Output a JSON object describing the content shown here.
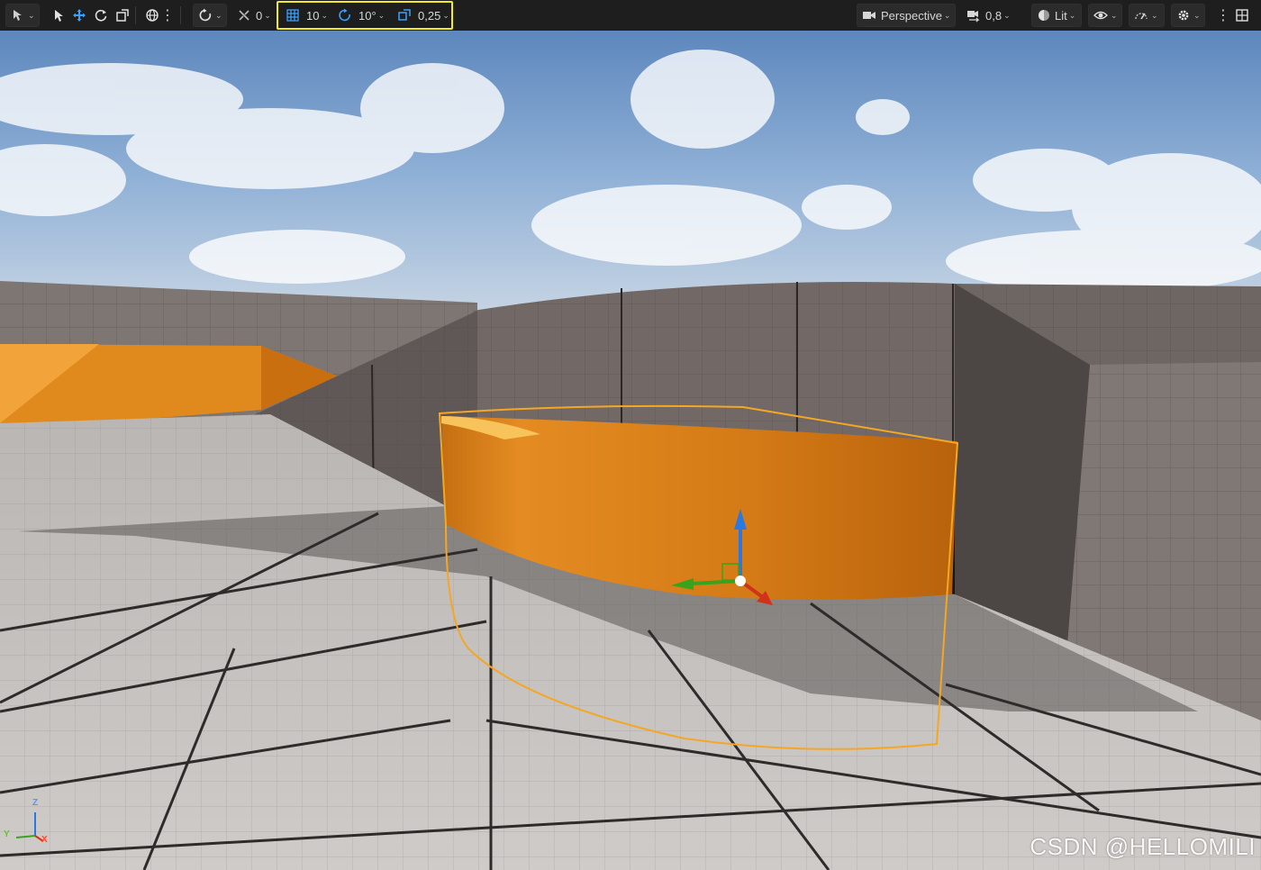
{
  "toolbar": {
    "grid_snap_value": "10",
    "rotation_snap_value": "10°",
    "scale_snap_value": "0,25",
    "surface_snap_value": "0",
    "view_mode_label": "Perspective",
    "lighting_mode_label": "Lit",
    "camera_speed_value": "0,8",
    "highlight_color": "#f2ea2a",
    "snap_icon_color": "#3aa0ff"
  },
  "viewport": {
    "selected_object_color": "#e08a1e",
    "selection_outline_color": "#f5a623"
  },
  "axis_indicator": {
    "z": "Z",
    "y": "Y",
    "x": "X"
  },
  "watermark": "CSDN @HELLOMILI"
}
